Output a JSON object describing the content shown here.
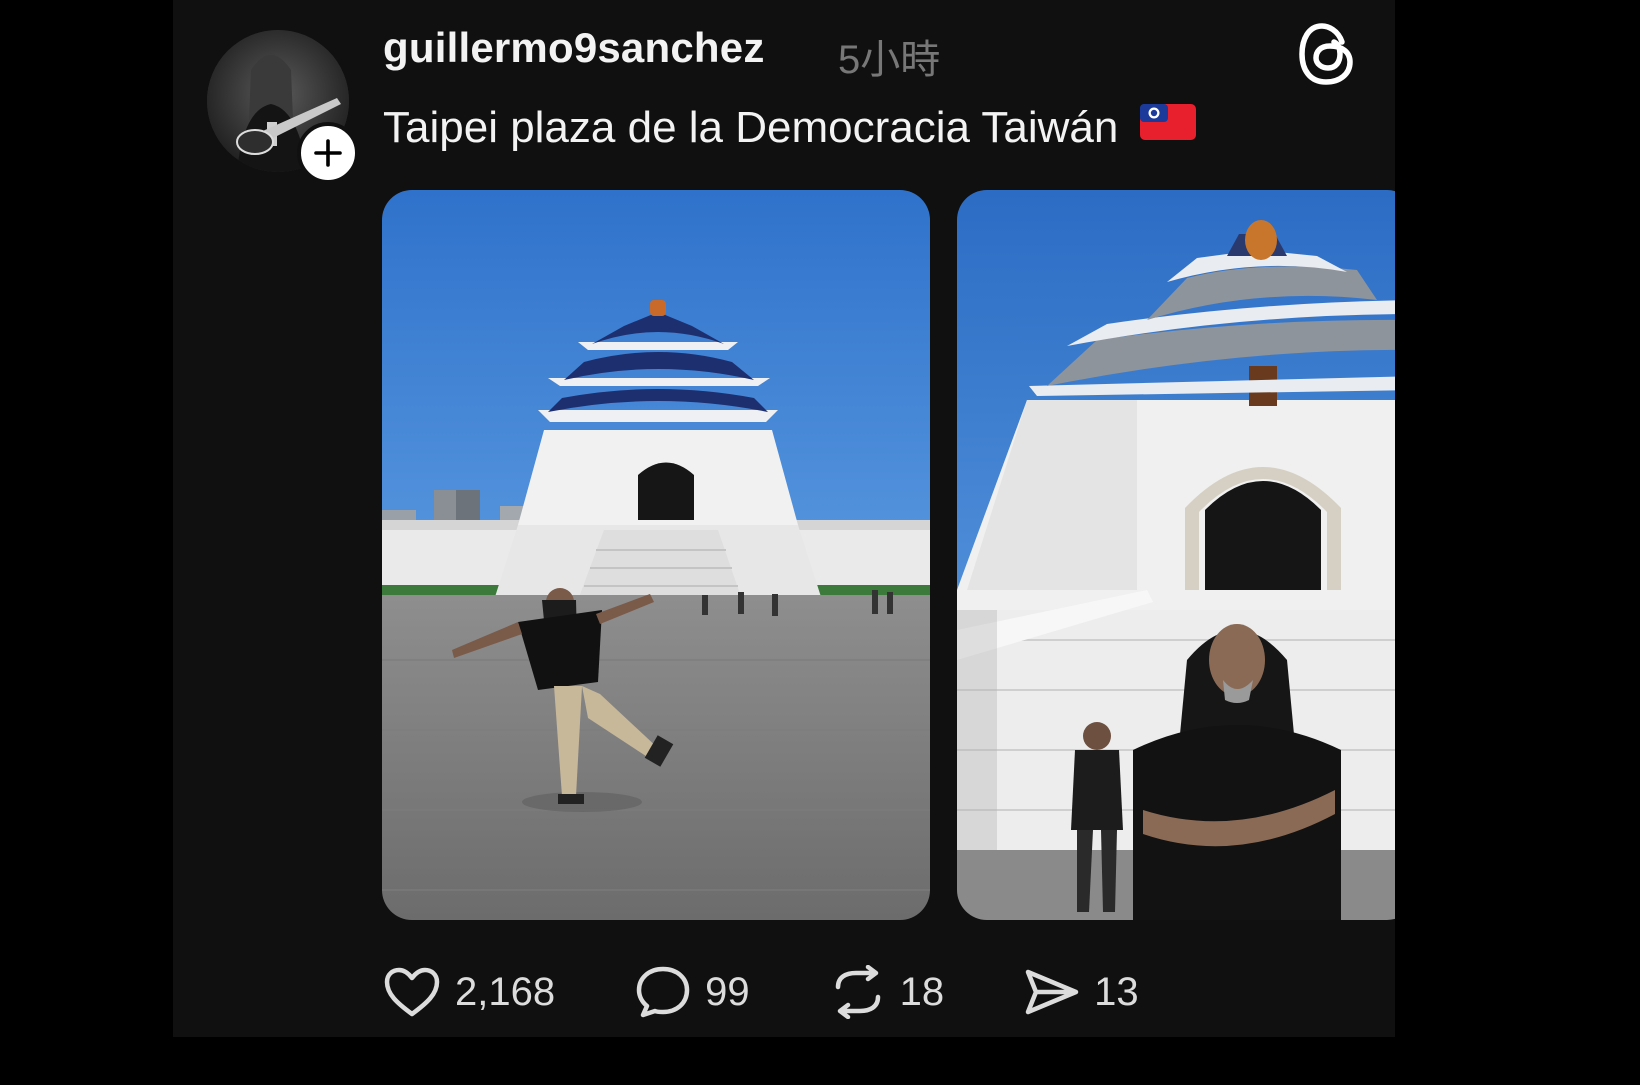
{
  "post": {
    "username": "guillermo9sanchez",
    "timestamp": "5小時",
    "caption": "Taipei plaza de la Democracia Taiwán",
    "caption_flag": "taiwan-flag-emoji",
    "media": [
      {
        "name": "photo-1",
        "description_icon": "memorial-hall-photo"
      },
      {
        "name": "photo-2",
        "description_icon": "memorial-hall-photo"
      }
    ],
    "actions": {
      "like_count": "2,168",
      "reply_count": "99",
      "repost_count": "18",
      "share_count": "13"
    },
    "colors": {
      "background": "#101010",
      "text": "#f3f3f3",
      "muted": "#777777",
      "sky": "#3d7fcf"
    }
  }
}
